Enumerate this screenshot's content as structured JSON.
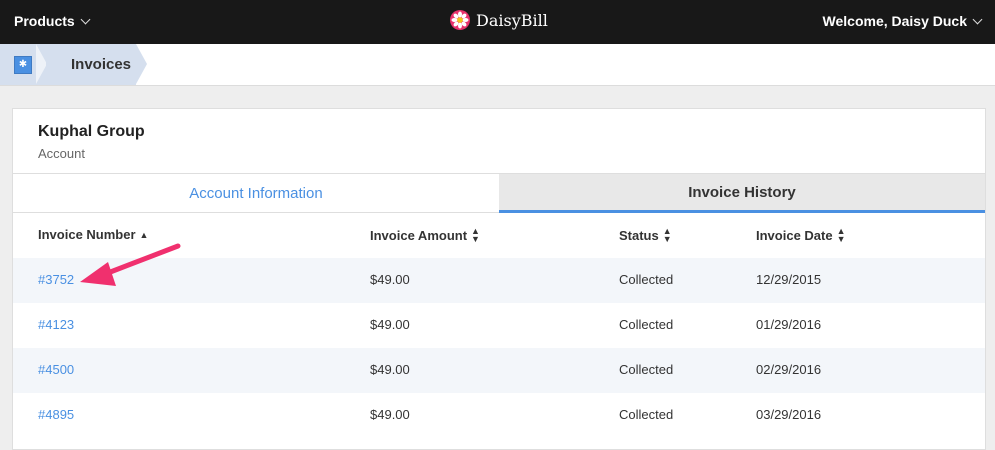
{
  "topbar": {
    "products_label": "Products",
    "brand_name": "DaisyBill",
    "welcome_text": "Welcome, Daisy Duck",
    "bg_color": "#181818"
  },
  "breadcrumb": {
    "home_icon": "app-home-icon",
    "current": "Invoices"
  },
  "account": {
    "name": "Kuphal Group",
    "type": "Account"
  },
  "tabs": [
    {
      "label": "Account Information",
      "active": false
    },
    {
      "label": "Invoice History",
      "active": true
    }
  ],
  "table": {
    "columns": [
      "Invoice Number",
      "Invoice Amount",
      "Status",
      "Invoice Date"
    ],
    "rows": [
      {
        "number": "#3752",
        "amount": "$49.00",
        "status": "Collected",
        "date": "12/29/2015"
      },
      {
        "number": "#4123",
        "amount": "$49.00",
        "status": "Collected",
        "date": "01/29/2016"
      },
      {
        "number": "#4500",
        "amount": "$49.00",
        "status": "Collected",
        "date": "02/29/2016"
      },
      {
        "number": "#4895",
        "amount": "$49.00",
        "status": "Collected",
        "date": "03/29/2016"
      }
    ]
  },
  "colors": {
    "accent": "#4a90e2",
    "annotation_arrow": "#f0306e",
    "row_alt": "#f3f6fa"
  }
}
